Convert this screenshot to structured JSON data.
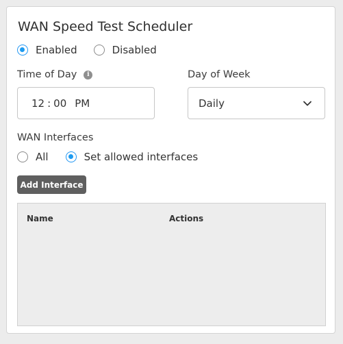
{
  "title": "WAN Speed Test Scheduler",
  "status": {
    "options": [
      {
        "label": "Enabled",
        "checked": true
      },
      {
        "label": "Disabled",
        "checked": false
      }
    ]
  },
  "time_of_day": {
    "label": "Time of Day",
    "info_icon": "info-icon",
    "hour": "12",
    "separator": ":",
    "minute": "00",
    "period": "PM"
  },
  "day_of_week": {
    "label": "Day of Week",
    "selected": "Daily",
    "icon": "chevron-down-icon"
  },
  "wan_interfaces": {
    "label": "WAN Interfaces",
    "options": [
      {
        "label": "All",
        "checked": false
      },
      {
        "label": "Set allowed interfaces",
        "checked": true
      }
    ]
  },
  "add_interface_button": "Add Interface",
  "table": {
    "columns": [
      "Name",
      "Actions"
    ],
    "rows": []
  },
  "colors": {
    "accent": "#1e9bf0",
    "button": "#5f5f5f",
    "table_bg": "#ededed"
  }
}
